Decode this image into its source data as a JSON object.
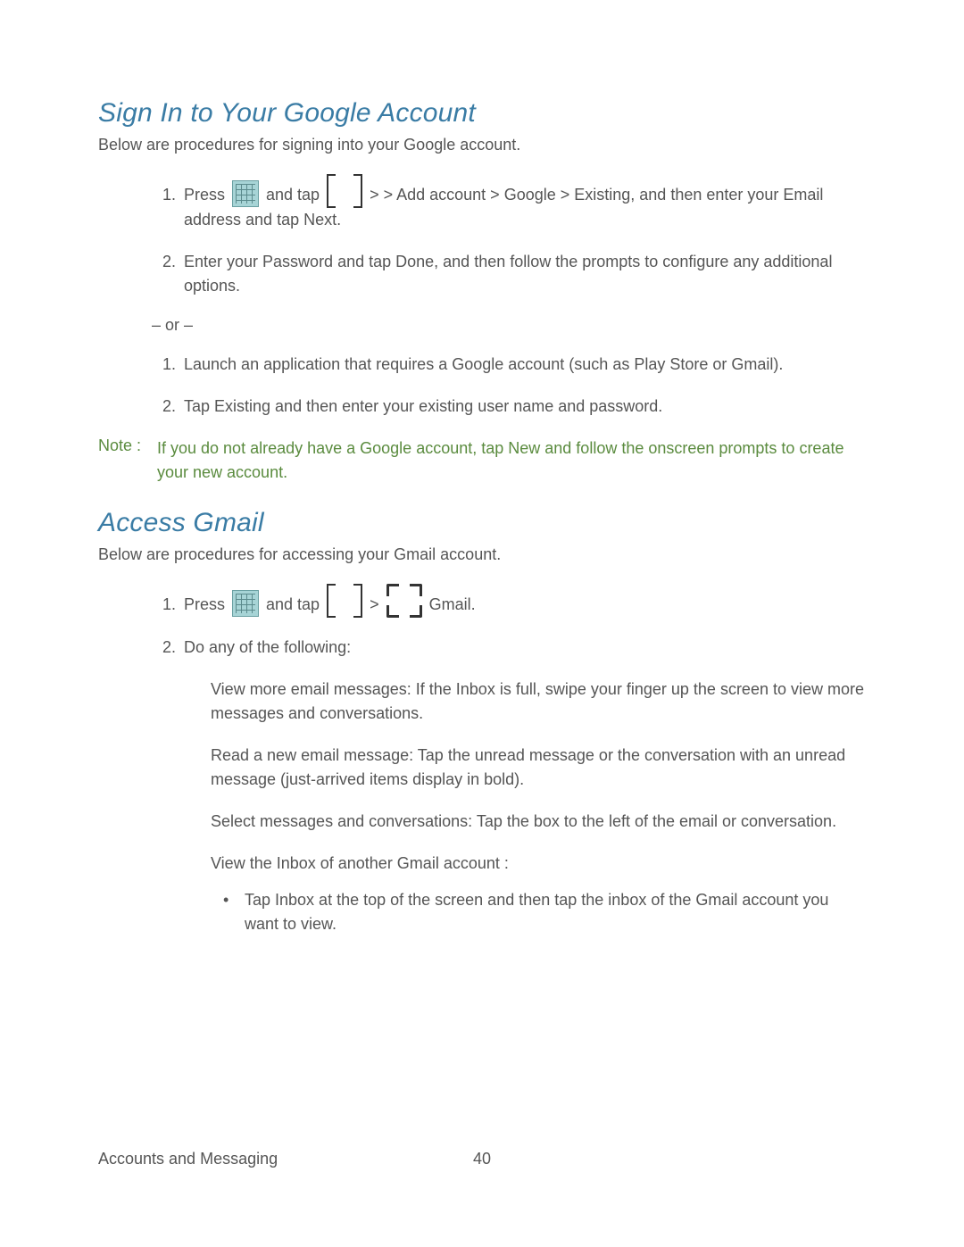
{
  "section1": {
    "heading": "Sign In to Your Google Account",
    "intro": "Below are procedures for signing into your Google account.",
    "step1_a": "Press ",
    "step1_b": " and tap ",
    "step1_c": " >       > Add account  > Google  > Existing, and then enter your Email address and tap Next.",
    "step2": "Enter your Password and tap Done,  and then follow the prompts to configure any additional options.",
    "or": "– or –",
    "alt1": "Launch an application that requires a Google account (such as Play Store or Gmail).",
    "alt2": "Tap Existing   and then enter your existing user name and password."
  },
  "note": {
    "label": "Note :",
    "text": "If you do not already have a Google account, tap New and follow the onscreen prompts to create your new account."
  },
  "section2": {
    "heading": "Access Gmail",
    "intro": "Below are procedures for accessing your Gmail account.",
    "step1_a": "Press ",
    "step1_b": " and tap ",
    "step1_c": " > ",
    "step1_d": " Gmail.",
    "step2": "Do any of the following:",
    "sub_a": "View more email messages: If the    Inbox is full, swipe your finger up the screen to view more messages and conversations.",
    "sub_b": "Read a new email message: Tap the unread message or the conversation with an unread message (just-arrived items display in bold).",
    "sub_c": "Select messages and conversations: Tap the box to the left of     the email or conversation.",
    "sub_d": "View the Inbox of another    Gmail account  :",
    "bullet": "Tap Inbox  at the top of the screen and then tap the inbox of the Gmail account you want to view."
  },
  "footer": {
    "section": "Accounts and Messaging",
    "page": "40"
  }
}
